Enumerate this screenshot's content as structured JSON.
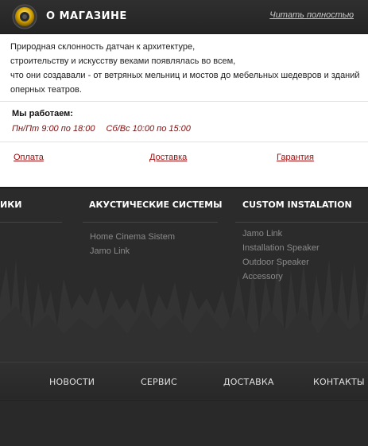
{
  "about": {
    "title": "О МАГАЗИНЕ",
    "read_more": "Читать полностью",
    "icon": "speaker-icon",
    "text_lines": [
      "Природная склонность датчан к архитектуре,",
      "строительству и искусству веками появлялась во всем,",
      "что они создавали - от ветряных мельниц и мостов до мебельных шедевров и зданий",
      "оперных театров."
    ]
  },
  "hours": {
    "title": "Мы работаем:",
    "weekdays": "Пн/Пт 9:00 по 18:00",
    "weekend": "Сб/Вс 10:00 по 15:00"
  },
  "info_links": [
    "Оплата",
    "Доставка",
    "Гарантия"
  ],
  "footer": {
    "columns": [
      {
        "title": "ИКИ",
        "links": []
      },
      {
        "title": "АКУСТИЧЕСКИЕ СИСТЕМЫ",
        "links": [
          "Home Cinema Sistem",
          "Jamo Link"
        ]
      },
      {
        "title": "CUSTOM INSTALATION",
        "links": [
          "Jamo Link",
          "Installation Speaker",
          "Outdoor Speaker",
          "Accessory"
        ]
      }
    ],
    "nav": [
      "НОВОСТИ",
      "СЕРВИС",
      "ДОСТАВКА",
      "КОНТАКТЫ"
    ]
  },
  "colors": {
    "header_bg": "#2b2b2b",
    "link_red": "#a01010",
    "hours_red": "#7a1010",
    "footer_bg": "#2b2b2b",
    "footer_link": "#8a8a8a"
  }
}
